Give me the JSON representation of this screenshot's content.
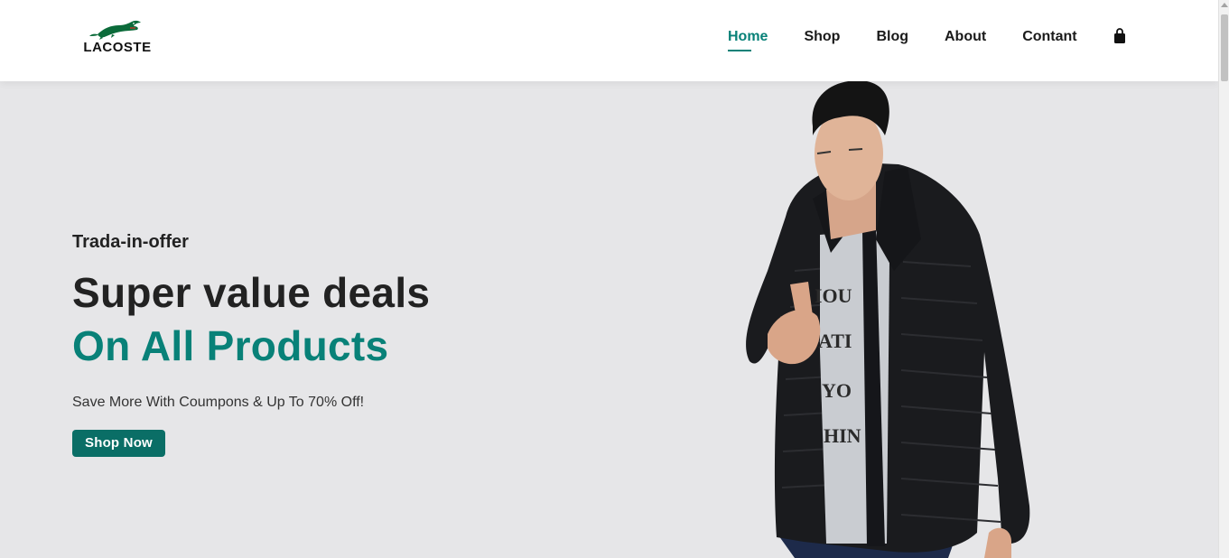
{
  "brand": {
    "logo_text": "LACOSTE",
    "logo_icon": "crocodile-icon",
    "logo_color": "#0b6b3a"
  },
  "nav": {
    "items": [
      {
        "label": "Home",
        "active": true
      },
      {
        "label": "Shop",
        "active": false
      },
      {
        "label": "Blog",
        "active": false
      },
      {
        "label": "About",
        "active": false
      },
      {
        "label": "Contant",
        "active": false
      }
    ],
    "cart_icon": "shopping-bag-icon"
  },
  "hero": {
    "offer": "Trada-in-offer",
    "headline": "Super value deals",
    "headline_accent": "On All Products",
    "subtext": "Save More With Coumpons & Up To 70% Off!",
    "button_label": "Shop Now",
    "image": "man-in-black-jacket-photo"
  },
  "colors": {
    "accent": "#088178",
    "button": "#0a6e66",
    "hero_bg": "#e6e6e8",
    "text_dark": "#222222"
  }
}
